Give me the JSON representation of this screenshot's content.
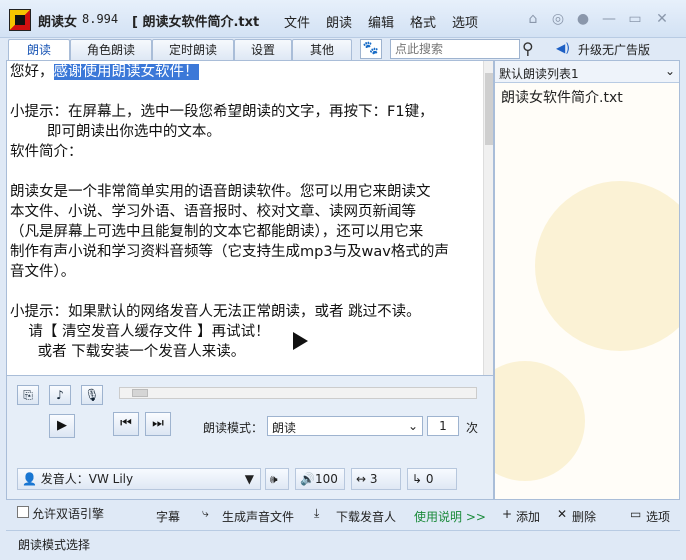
{
  "titlebar": {
    "app_name": "朗读女",
    "version": "8.994",
    "doc_title": "[ 朗读女软件简介.txt",
    "menu": [
      "文件",
      "朗读",
      "编辑",
      "格式",
      "选项"
    ]
  },
  "tabs": [
    "朗读",
    "角色朗读",
    "定时朗读",
    "设置",
    "其他"
  ],
  "search": {
    "placeholder": "点此搜索"
  },
  "upgrade_label": "升级无广告版",
  "text_lines": [
    "您好，",
    "感谢使用朗读女软件！",
    "",
    "小提示：在屏幕上，选中一段您希望朗读的文字，再按下：F1键，",
    "        即可朗读出你选中的文本。",
    "软件简介：",
    "",
    "朗读女是一个非常简单实用的语音朗读软件。您可以用它来朗读文",
    "本文件、小说、学习外语、语音报时、校对文章、读网页新闻等",
    "（凡是屏幕上可选中且能复制的文本它都能朗读），还可以用它来",
    "制作有声小说和学习资料音频等（它支持生成mp3与及wav格式的声",
    "音文件）。",
    "",
    "小提示：如果默认的网络发音人无法正常朗读，或者 跳过不读。",
    "    请【 清空发音人缓存文件 】再试试！",
    "      或者 下载安装一个发音人来读。"
  ],
  "list": {
    "header": "默认朗读列表1",
    "item": "朗读女软件简介.txt"
  },
  "controls": {
    "mode_label": "朗读模式：",
    "mode_value": "朗读",
    "repeat_count": "1",
    "repeat_unit": "次",
    "voice_label": "发音人：VW Lily",
    "volume": "100",
    "speed": "3",
    "pitch": "0"
  },
  "bottom": {
    "bilingual": "允许双语引擎",
    "subtitles": "字幕",
    "gen_audio": "生成声音文件",
    "download_voice": "下载发音人",
    "help": "使用说明 >>",
    "add": "添加",
    "delete": "删除",
    "options": "选项"
  },
  "status": "朗读模式选择"
}
